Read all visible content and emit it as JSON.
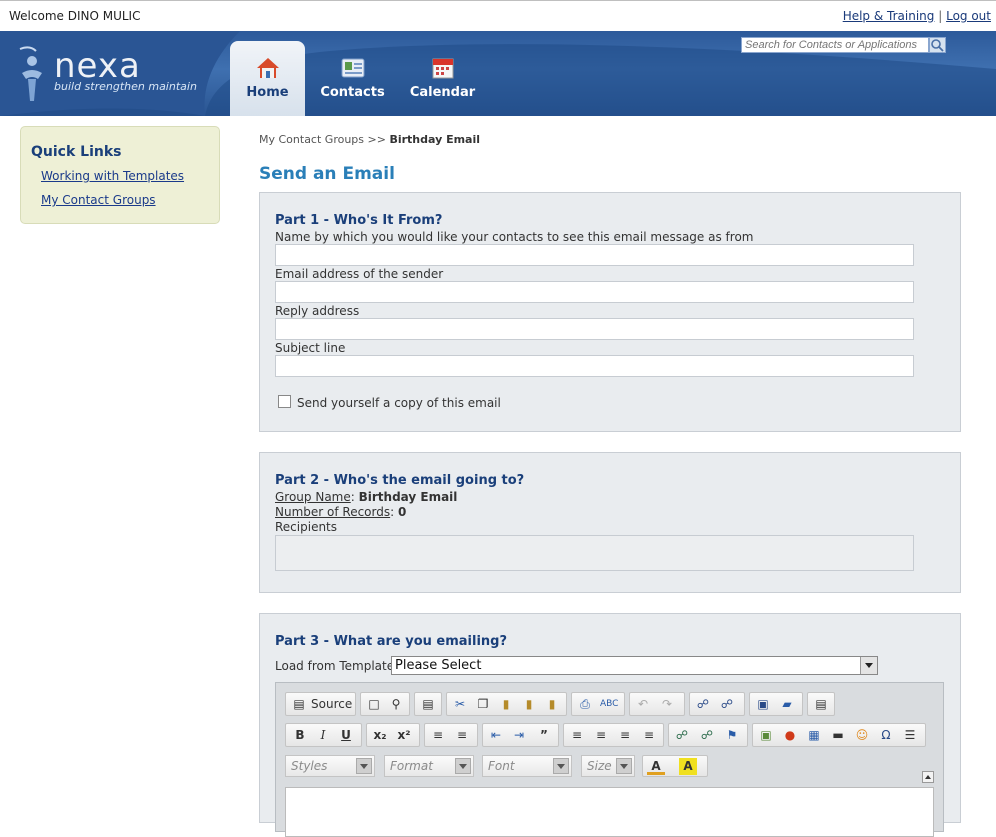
{
  "topbar": {
    "welcome": "Welcome DINO MULIC",
    "help_link": "Help & Training",
    "separator": "|",
    "logout_link": "Log out"
  },
  "logo": {
    "word": "nexa",
    "tagline": "build strengthen maintain"
  },
  "nav": {
    "home": "Home",
    "contacts": "Contacts",
    "calendar": "Calendar"
  },
  "search": {
    "placeholder": "Search for Contacts or Applications"
  },
  "quick_links": {
    "title": "Quick Links",
    "items": [
      "Working with Templates",
      "My Contact Groups"
    ]
  },
  "breadcrumb": {
    "parent": "My Contact Groups",
    "sep": ">>",
    "current": "Birthday Email"
  },
  "page_title": "Send an Email",
  "part1": {
    "title": "Part 1 - Who's It From?",
    "from_name_label": "Name by which you would like your contacts to see this email message as from",
    "sender_email_label": "Email address of the sender",
    "reply_label": "Reply address",
    "subject_label": "Subject line",
    "copy_label": "Send yourself a copy of this email"
  },
  "part2": {
    "title": "Part 2 - Who's the email going to?",
    "group_name_key": "Group Name",
    "group_name_value": "Birthday Email",
    "records_key": "Number of Records",
    "records_value": "0",
    "recipients_label": "Recipients"
  },
  "part3": {
    "title": "Part 3 - What are you emailing?",
    "template_label": "Load from Template:",
    "template_value": "Please Select",
    "source_label": "Source",
    "styles": "Styles",
    "format": "Format",
    "font": "Font",
    "size": "Size"
  },
  "colors": {
    "header": "#2d5a9a",
    "title": "#2a7fb8",
    "heading": "#1a3f7a",
    "quick_bg": "#eef0d6",
    "panel_bg": "#e9ecef"
  }
}
